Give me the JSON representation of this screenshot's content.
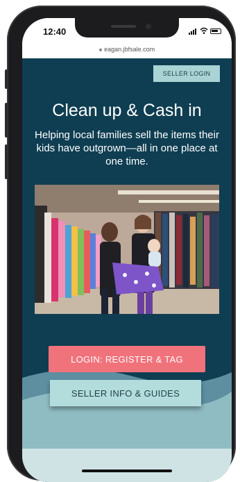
{
  "status_bar": {
    "time": "12:40",
    "url": "eagan.jbfsale.com"
  },
  "page": {
    "seller_login_label": "SELLER LOGIN",
    "headline": "Clean up & Cash in",
    "subheadline": "Helping local families sell the items their kids have outgrown—all in one place at one time.",
    "primary_button_label": "LOGIN: REGISTER & TAG",
    "secondary_button_label": "SELLER INFO & GUIDES"
  },
  "colors": {
    "page_background": "#0f3e52",
    "primary_button": "#f0727b",
    "secondary_button": "#b3dcdc",
    "seller_login_button": "#a9d3d4",
    "wave_light": "#cfe3e4"
  },
  "icons": [
    "lock-icon",
    "signal-icon",
    "wifi-icon",
    "battery-icon"
  ]
}
